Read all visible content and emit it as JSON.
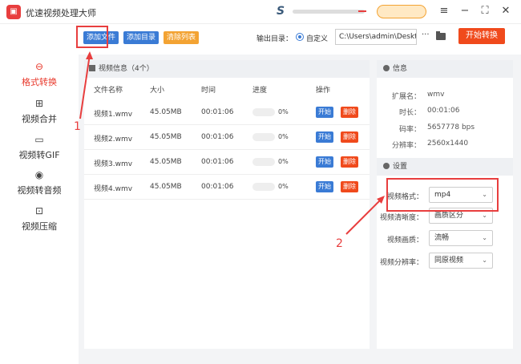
{
  "titlebar": {
    "app_title": "优速视频处理大师",
    "logo_glyph": "▣",
    "s_logo": "S",
    "menu_icon": "≡",
    "minimize_icon": "−",
    "maximize_icon": "⛶",
    "close_icon": "✕"
  },
  "sidebar": {
    "items": [
      {
        "label": "格式转换",
        "icon": "⊖"
      },
      {
        "label": "视频合并",
        "icon": "⊞"
      },
      {
        "label": "视频转GIF",
        "icon": "▭"
      },
      {
        "label": "视频转音频",
        "icon": "◉"
      },
      {
        "label": "视频压缩",
        "icon": "⊡"
      }
    ]
  },
  "toolbar": {
    "add_file": "添加文件",
    "add_dir": "添加目录",
    "clear_list": "清除列表",
    "output_label": "输出目录：",
    "custom_label": "自定义",
    "path_value": "C:\\Users\\admin\\Deskto",
    "dots": "···",
    "start_convert": "开始转换"
  },
  "file_panel": {
    "header": "视频信息（4个）",
    "columns": {
      "name": "文件名称",
      "size": "大小",
      "time": "时间",
      "progress": "进度",
      "action": "操作"
    },
    "rows": [
      {
        "name": "视频1.wmv",
        "size": "45.05MB",
        "time": "00:01:06",
        "progress_pct": "0%",
        "progress": 0
      },
      {
        "name": "视频2.wmv",
        "size": "45.05MB",
        "time": "00:01:06",
        "progress_pct": "0%",
        "progress": 0
      },
      {
        "name": "视频3.wmv",
        "size": "45.05MB",
        "time": "00:01:06",
        "progress_pct": "0%",
        "progress": 0
      },
      {
        "name": "视频4.wmv",
        "size": "45.05MB",
        "time": "00:01:06",
        "progress_pct": "0%",
        "progress": 0
      }
    ],
    "start_label": "开始",
    "delete_label": "删除"
  },
  "info_panel": {
    "header": "信息",
    "ext_label": "扩展名：",
    "ext_value": "wmv",
    "duration_label": "时长：",
    "duration_value": "00:01:06",
    "bitrate_label": "码率：",
    "bitrate_value": "5657778 bps",
    "resolution_label": "分辨率：",
    "resolution_value": "2560x1440"
  },
  "settings_panel": {
    "header": "设置",
    "format_label": "视频格式：",
    "format_value": "mp4",
    "clarity_label": "视频清晰度：",
    "clarity_value": "画质区分",
    "quality_label": "视频画质：",
    "quality_value": "流畅",
    "res_label": "视频分辨率：",
    "res_value": "同原视频"
  },
  "annotations": {
    "one": "1",
    "two": "2"
  },
  "colors": {
    "accent_red": "#e8392c",
    "blue": "#3a7bd5",
    "orange": "#f3a333",
    "start_orange": "#f04a1c",
    "delete_red": "#f04a1c"
  }
}
